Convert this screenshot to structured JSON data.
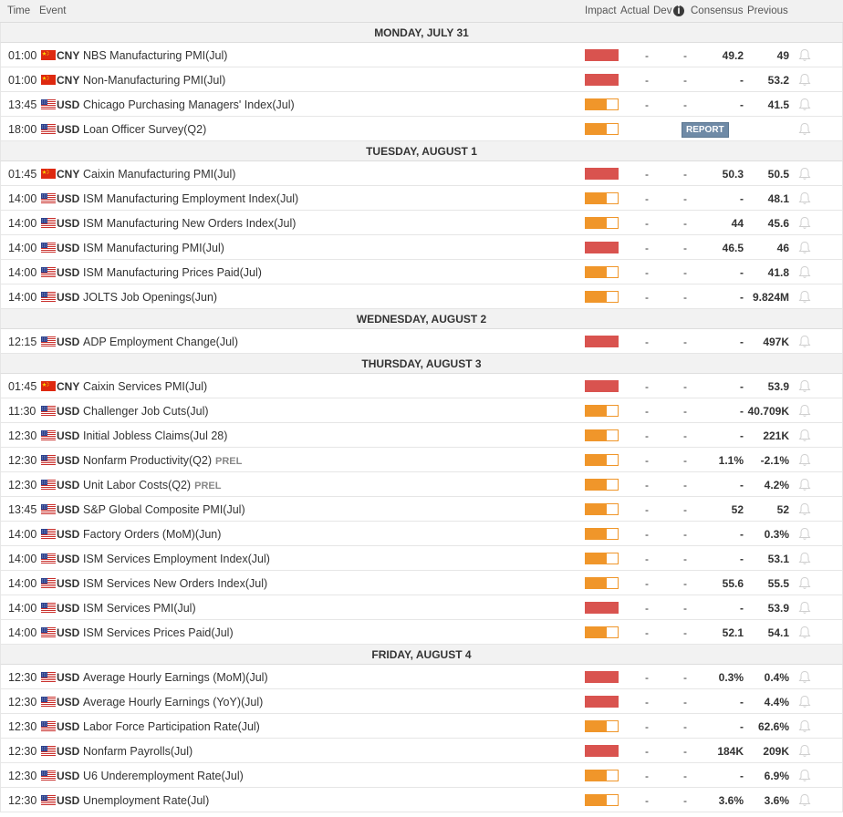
{
  "header": {
    "time": "Time",
    "event": "Event",
    "impact": "Impact",
    "actual": "Actual",
    "dev": "Dev",
    "info_icon": "i",
    "consensus": "Consensus",
    "previous": "Previous"
  },
  "colors": {
    "high_impact": "#d9534f",
    "medium_impact": "#f0962a",
    "report_badge": "#6f8aa6"
  },
  "icons": {
    "cny_flag": "china-flag-icon",
    "usd_flag": "us-flag-icon",
    "alert": "bell-icon",
    "info": "info-icon"
  },
  "days": [
    {
      "label": "MONDAY, JULY 31",
      "events": [
        {
          "time": "01:00",
          "currency": "CNY",
          "event": "NBS Manufacturing PMI(Jul)",
          "tag": "",
          "impact": "high",
          "actual": "-",
          "dev": "-",
          "consensus": "49.2",
          "previous": "49",
          "report": ""
        },
        {
          "time": "01:00",
          "currency": "CNY",
          "event": "Non-Manufacturing PMI(Jul)",
          "tag": "",
          "impact": "high",
          "actual": "-",
          "dev": "-",
          "consensus": "-",
          "previous": "53.2",
          "report": ""
        },
        {
          "time": "13:45",
          "currency": "USD",
          "event": "Chicago Purchasing Managers' Index(Jul)",
          "tag": "",
          "impact": "medium",
          "actual": "-",
          "dev": "-",
          "consensus": "-",
          "previous": "41.5",
          "report": ""
        },
        {
          "time": "18:00",
          "currency": "USD",
          "event": "Loan Officer Survey(Q2)",
          "tag": "",
          "impact": "medium",
          "actual": "",
          "dev": "",
          "consensus": "",
          "previous": "",
          "report": "REPORT"
        }
      ]
    },
    {
      "label": "TUESDAY, AUGUST 1",
      "events": [
        {
          "time": "01:45",
          "currency": "CNY",
          "event": "Caixin Manufacturing PMI(Jul)",
          "tag": "",
          "impact": "high",
          "actual": "-",
          "dev": "-",
          "consensus": "50.3",
          "previous": "50.5",
          "report": ""
        },
        {
          "time": "14:00",
          "currency": "USD",
          "event": "ISM Manufacturing Employment Index(Jul)",
          "tag": "",
          "impact": "medium",
          "actual": "-",
          "dev": "-",
          "consensus": "-",
          "previous": "48.1",
          "report": ""
        },
        {
          "time": "14:00",
          "currency": "USD",
          "event": "ISM Manufacturing New Orders Index(Jul)",
          "tag": "",
          "impact": "medium",
          "actual": "-",
          "dev": "-",
          "consensus": "44",
          "previous": "45.6",
          "report": ""
        },
        {
          "time": "14:00",
          "currency": "USD",
          "event": "ISM Manufacturing PMI(Jul)",
          "tag": "",
          "impact": "high",
          "actual": "-",
          "dev": "-",
          "consensus": "46.5",
          "previous": "46",
          "report": ""
        },
        {
          "time": "14:00",
          "currency": "USD",
          "event": "ISM Manufacturing Prices Paid(Jul)",
          "tag": "",
          "impact": "medium",
          "actual": "-",
          "dev": "-",
          "consensus": "-",
          "previous": "41.8",
          "report": ""
        },
        {
          "time": "14:00",
          "currency": "USD",
          "event": "JOLTS Job Openings(Jun)",
          "tag": "",
          "impact": "medium",
          "actual": "-",
          "dev": "-",
          "consensus": "-",
          "previous": "9.824M",
          "report": ""
        }
      ]
    },
    {
      "label": "WEDNESDAY, AUGUST 2",
      "events": [
        {
          "time": "12:15",
          "currency": "USD",
          "event": "ADP Employment Change(Jul)",
          "tag": "",
          "impact": "high",
          "actual": "-",
          "dev": "-",
          "consensus": "-",
          "previous": "497K",
          "report": ""
        }
      ]
    },
    {
      "label": "THURSDAY, AUGUST 3",
      "events": [
        {
          "time": "01:45",
          "currency": "CNY",
          "event": "Caixin Services PMI(Jul)",
          "tag": "",
          "impact": "high",
          "actual": "-",
          "dev": "-",
          "consensus": "-",
          "previous": "53.9",
          "report": ""
        },
        {
          "time": "11:30",
          "currency": "USD",
          "event": "Challenger Job Cuts(Jul)",
          "tag": "",
          "impact": "medium",
          "actual": "-",
          "dev": "-",
          "consensus": "-",
          "previous": "40.709K",
          "report": ""
        },
        {
          "time": "12:30",
          "currency": "USD",
          "event": "Initial Jobless Claims(Jul 28)",
          "tag": "",
          "impact": "medium",
          "actual": "-",
          "dev": "-",
          "consensus": "-",
          "previous": "221K",
          "report": ""
        },
        {
          "time": "12:30",
          "currency": "USD",
          "event": "Nonfarm Productivity(Q2)",
          "tag": "PREL",
          "impact": "medium",
          "actual": "-",
          "dev": "-",
          "consensus": "1.1%",
          "previous": "-2.1%",
          "report": ""
        },
        {
          "time": "12:30",
          "currency": "USD",
          "event": "Unit Labor Costs(Q2)",
          "tag": "PREL",
          "impact": "medium",
          "actual": "-",
          "dev": "-",
          "consensus": "-",
          "previous": "4.2%",
          "report": ""
        },
        {
          "time": "13:45",
          "currency": "USD",
          "event": "S&P Global Composite PMI(Jul)",
          "tag": "",
          "impact": "medium",
          "actual": "-",
          "dev": "-",
          "consensus": "52",
          "previous": "52",
          "report": ""
        },
        {
          "time": "14:00",
          "currency": "USD",
          "event": "Factory Orders (MoM)(Jun)",
          "tag": "",
          "impact": "medium",
          "actual": "-",
          "dev": "-",
          "consensus": "-",
          "previous": "0.3%",
          "report": ""
        },
        {
          "time": "14:00",
          "currency": "USD",
          "event": "ISM Services Employment Index(Jul)",
          "tag": "",
          "impact": "medium",
          "actual": "-",
          "dev": "-",
          "consensus": "-",
          "previous": "53.1",
          "report": ""
        },
        {
          "time": "14:00",
          "currency": "USD",
          "event": "ISM Services New Orders Index(Jul)",
          "tag": "",
          "impact": "medium",
          "actual": "-",
          "dev": "-",
          "consensus": "55.6",
          "previous": "55.5",
          "report": ""
        },
        {
          "time": "14:00",
          "currency": "USD",
          "event": "ISM Services PMI(Jul)",
          "tag": "",
          "impact": "high",
          "actual": "-",
          "dev": "-",
          "consensus": "-",
          "previous": "53.9",
          "report": ""
        },
        {
          "time": "14:00",
          "currency": "USD",
          "event": "ISM Services Prices Paid(Jul)",
          "tag": "",
          "impact": "medium",
          "actual": "-",
          "dev": "-",
          "consensus": "52.1",
          "previous": "54.1",
          "report": ""
        }
      ]
    },
    {
      "label": "FRIDAY, AUGUST 4",
      "events": [
        {
          "time": "12:30",
          "currency": "USD",
          "event": "Average Hourly Earnings (MoM)(Jul)",
          "tag": "",
          "impact": "high",
          "actual": "-",
          "dev": "-",
          "consensus": "0.3%",
          "previous": "0.4%",
          "report": ""
        },
        {
          "time": "12:30",
          "currency": "USD",
          "event": "Average Hourly Earnings (YoY)(Jul)",
          "tag": "",
          "impact": "high",
          "actual": "-",
          "dev": "-",
          "consensus": "-",
          "previous": "4.4%",
          "report": ""
        },
        {
          "time": "12:30",
          "currency": "USD",
          "event": "Labor Force Participation Rate(Jul)",
          "tag": "",
          "impact": "medium",
          "actual": "-",
          "dev": "-",
          "consensus": "-",
          "previous": "62.6%",
          "report": ""
        },
        {
          "time": "12:30",
          "currency": "USD",
          "event": "Nonfarm Payrolls(Jul)",
          "tag": "",
          "impact": "high",
          "actual": "-",
          "dev": "-",
          "consensus": "184K",
          "previous": "209K",
          "report": ""
        },
        {
          "time": "12:30",
          "currency": "USD",
          "event": "U6 Underemployment Rate(Jul)",
          "tag": "",
          "impact": "medium",
          "actual": "-",
          "dev": "-",
          "consensus": "-",
          "previous": "6.9%",
          "report": ""
        },
        {
          "time": "12:30",
          "currency": "USD",
          "event": "Unemployment Rate(Jul)",
          "tag": "",
          "impact": "medium",
          "actual": "-",
          "dev": "-",
          "consensus": "3.6%",
          "previous": "3.6%",
          "report": ""
        }
      ]
    }
  ]
}
